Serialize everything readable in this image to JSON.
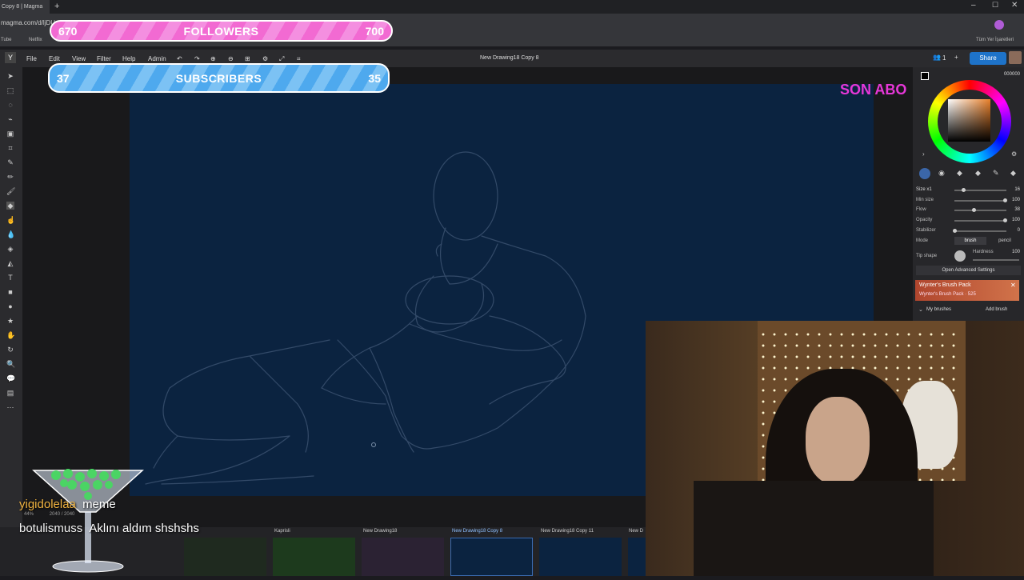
{
  "browser": {
    "tab_title": "Copy 8 | Magma",
    "url": "magma.com/d/ljDU",
    "bookmarks": [
      "Tube",
      "Netflix"
    ],
    "all_bookmarks": "Tüm Yer İşaretleri"
  },
  "menu": [
    "File",
    "Edit",
    "View",
    "Filter",
    "Help",
    "Admin"
  ],
  "document_title": "New Drawing18 Copy 8",
  "collab_count": "1",
  "share_label": "Share",
  "color": {
    "hex": "000000",
    "selected": "#e8a060"
  },
  "brush": {
    "size_label": "Size x1",
    "size": "16",
    "min_size_label": "Min size",
    "min_size": "100",
    "flow_label": "Flow",
    "flow": "38",
    "opacity_label": "Opacity",
    "opacity": "100",
    "stabilizer_label": "Stabilizer",
    "stabilizer": "0",
    "mode_label": "Mode",
    "mode_options": [
      "brush",
      "pencil"
    ],
    "tip_shape_label": "Tip shape",
    "hardness_label": "Hardness",
    "hardness": "100",
    "advanced_label": "Open Advanced Settings",
    "pack_title": "Wynter's Brush Pack",
    "pack_subtitle": "Wynter's Brush Pack · 525",
    "my_brushes_label": "My brushes",
    "add_brush_label": "Add brush"
  },
  "thumbnails": [
    {
      "label": "Kaprisli"
    },
    {
      "label": "New Drawing18"
    },
    {
      "label": "New Drawing18 Copy 8"
    },
    {
      "label": "New Drawing18 Copy 11"
    },
    {
      "label": "New D"
    }
  ],
  "zoom_info": {
    "zoom": "44%",
    "dimensions": "2040 / 2040"
  },
  "overlays": {
    "followers": {
      "left": "670",
      "label": "FOLLOWERS",
      "right": "700"
    },
    "subscribers": {
      "left": "37",
      "label": "SUBSCRIBERS",
      "right": "35"
    },
    "ticker": "SON ABO"
  },
  "chat": [
    {
      "user": "yigidolelaa",
      "message": "meme"
    },
    {
      "user": "botulismuss",
      "message": "Aklını aldım shshshs"
    }
  ]
}
